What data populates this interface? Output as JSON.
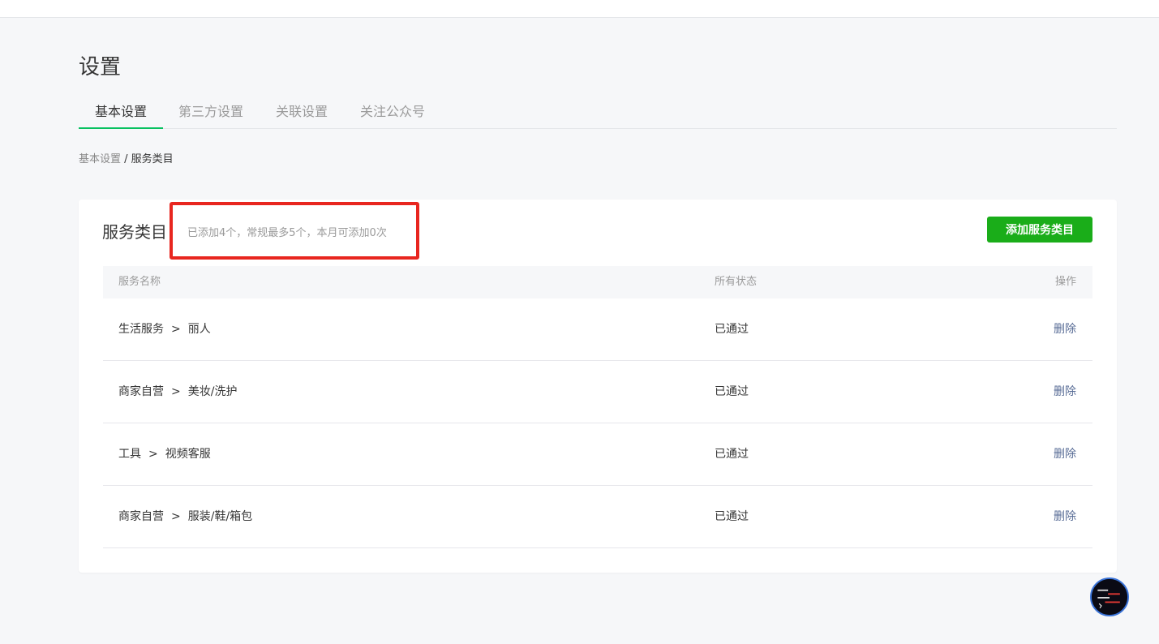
{
  "page": {
    "title": "设置"
  },
  "tabs": [
    {
      "label": "基本设置",
      "active": true
    },
    {
      "label": "第三方设置",
      "active": false
    },
    {
      "label": "关联设置",
      "active": false
    },
    {
      "label": "关注公众号",
      "active": false
    }
  ],
  "breadcrumb": {
    "parent": "基本设置",
    "separator": " / ",
    "current": "服务类目"
  },
  "card": {
    "title": "服务类目",
    "note": "已添加4个，常规最多5个，本月可添加0次",
    "add_button": "添加服务类目"
  },
  "table": {
    "headers": {
      "name": "服务名称",
      "status": "所有状态",
      "op": "操作"
    },
    "rows": [
      {
        "category": "生活服务",
        "arrow": ">",
        "sub": "丽人",
        "status": "已通过",
        "op": "删除"
      },
      {
        "category": "商家自营",
        "arrow": ">",
        "sub": "美妆/洗护",
        "status": "已通过",
        "op": "删除"
      },
      {
        "category": "工具",
        "arrow": ">",
        "sub": "视频客服",
        "status": "已通过",
        "op": "删除"
      },
      {
        "category": "商家自营",
        "arrow": ">",
        "sub": "服装/鞋/箱包",
        "status": "已通过",
        "op": "删除"
      }
    ]
  },
  "colors": {
    "accent": "#07c160",
    "button": "#1aad19",
    "link": "#576b95",
    "highlight": "#e8261f"
  },
  "floating_badge": {
    "icon": "avatar-badge-icon"
  }
}
